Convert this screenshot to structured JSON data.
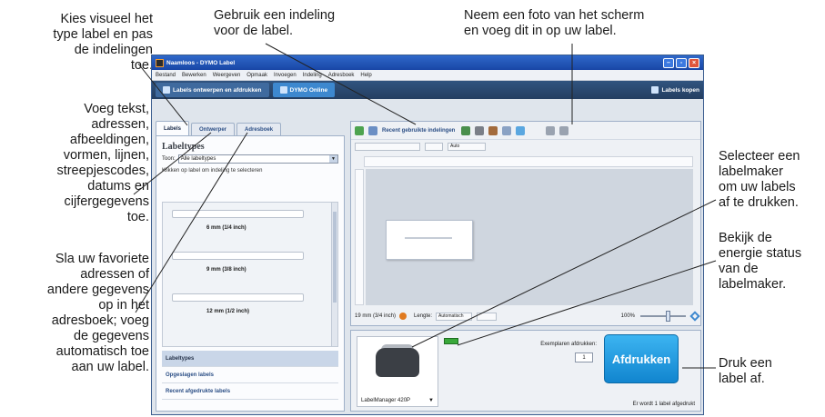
{
  "callouts": {
    "visual_type": "Kies visueel het\ntype label en pas\nde indelingen\ntoe.",
    "use_layout": "Gebruik een indeling\nvoor de label.",
    "photo": "Neem een foto van het scherm\nen voeg dit in op uw label.",
    "add_content": "Voeg tekst,\nadressen,\nafbeeldingen,\nvormen, lijnen,\nstreepjescodes,\ndatums en\ncijfergegevens\ntoe.",
    "addressbook": "Sla uw favoriete\nadressen of\nandere gegevens\nop in het\nadresboek; voeg\nde gegevens\nautomatisch toe\naan uw label.",
    "select_printer": "Selecteer een\nlabelmaker\nom uw labels\naf te drukken.",
    "energy": "Bekijk de\nenergie status\nvan de\nlabelmaker.",
    "print": "Druk een\nlabel af."
  },
  "window": {
    "title": "Naamloos - DYMO Label",
    "controls": {
      "minimize": "–",
      "maximize": "▫",
      "close": "×"
    },
    "menu": [
      "Bestand",
      "Bewerken",
      "Weergeven",
      "Opmaak",
      "Invoegen",
      "Indeling",
      "Adresboek",
      "Help"
    ],
    "modes": {
      "design": "Labels ontwerpen en afdrukken",
      "online": "DYMO Online",
      "buy": "Labels kopen"
    }
  },
  "left_panel": {
    "tabs": [
      "Labels",
      "Ontwerper",
      "Adresboek"
    ],
    "title": "Labeltypes",
    "view_label": "Toon:",
    "view_value": "Alle labeltypes",
    "hint": "Klikken op label om indeling te selecteren",
    "layouts": [
      "6 mm (1/4 inch)",
      "9 mm (3/8 inch)",
      "12 mm (1/2 inch)"
    ],
    "categories": [
      "Labeltypes",
      "Opgeslagen labels",
      "Recent afgedrukte labels"
    ]
  },
  "editor": {
    "recent_layouts": "Recent gebruikte indelingen",
    "font_size": "Auto",
    "label_size": "19 mm (3/4 inch)",
    "length_label": "Lengte:",
    "length_mode": "Automatisch",
    "zoom": "100%"
  },
  "printer": {
    "name": "LabelManager 420P",
    "copies_label": "Exemplaren afdrukken:",
    "copies": "1",
    "print_button": "Afdrukken",
    "status": "Er wordt 1 label afgedrukt"
  },
  "colors": {
    "titlebar": "#1946a6",
    "print_button": "#1185cf",
    "battery": "#38a83a"
  }
}
